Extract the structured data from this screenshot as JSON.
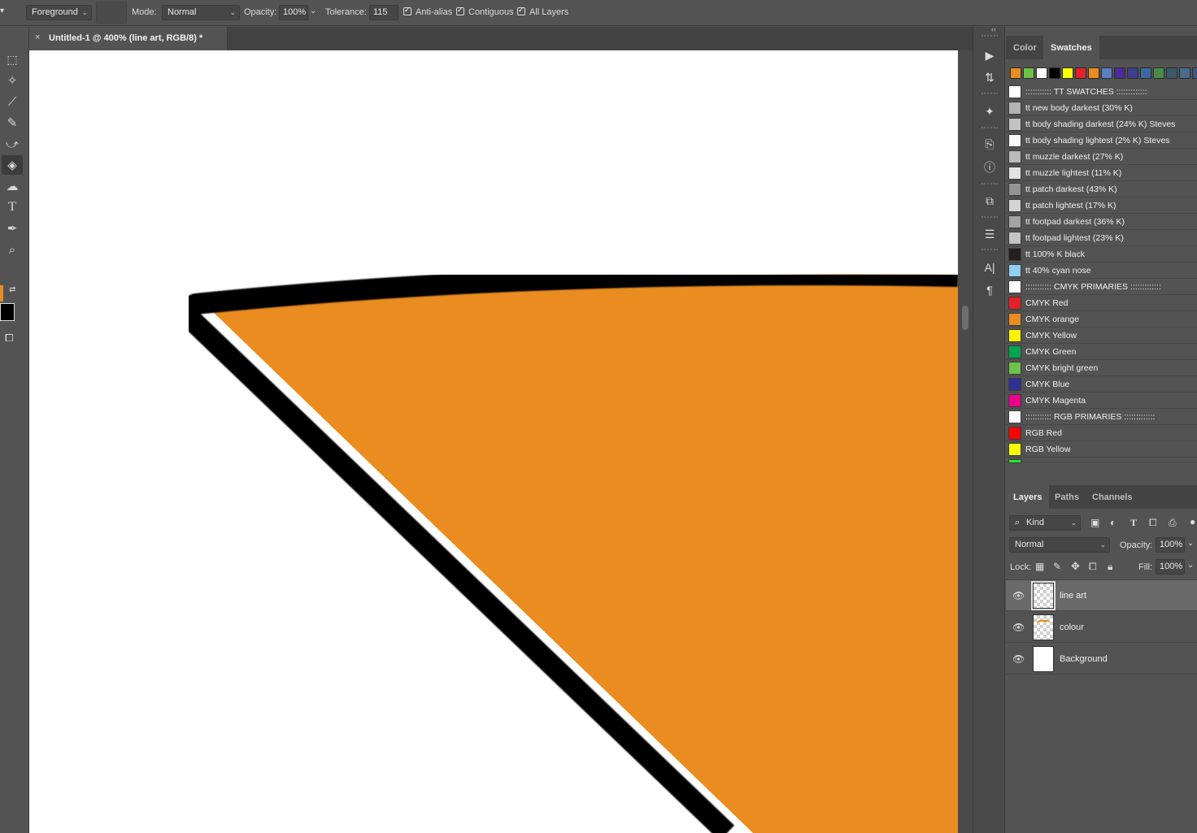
{
  "options_bar": {
    "tool_icon": "paint-bucket-icon",
    "fill_source": "Foreground",
    "mode_label": "Mode:",
    "mode_value": "Normal",
    "opacity_label": "Opacity:",
    "opacity_value": "100%",
    "tolerance_label": "Tolerance:",
    "tolerance_value": "115",
    "anti_alias_label": "Anti-alias",
    "anti_alias_checked": true,
    "contiguous_label": "Contiguous",
    "contiguous_checked": true,
    "all_layers_label": "All Layers",
    "all_layers_checked": true
  },
  "document": {
    "tab_title": "Untitled-1 @ 400% (line art, RGB/8) *",
    "fill_color": "#ea8c1f",
    "line_color": "#000000"
  },
  "colors": {
    "foreground": "#ea8c1f",
    "background": "#000000"
  },
  "toolbar": {
    "tools": [
      {
        "name": "marquee-tool",
        "glyph": "⬚"
      },
      {
        "name": "magic-wand-tool",
        "glyph": "✧"
      },
      {
        "name": "eyedropper-tool",
        "glyph": "⟋"
      },
      {
        "name": "brush-tool",
        "glyph": "✎"
      },
      {
        "name": "history-brush-tool",
        "glyph": "⤻"
      },
      {
        "name": "paint-bucket-tool",
        "glyph": "◈"
      },
      {
        "name": "smudge-tool",
        "glyph": "☁"
      },
      {
        "name": "type-tool",
        "glyph": "T"
      },
      {
        "name": "pen-tool",
        "glyph": "✒"
      },
      {
        "name": "zoom-tool",
        "glyph": "⌕"
      }
    ]
  },
  "right_icons": [
    {
      "name": "play-icon",
      "glyph": "▶"
    },
    {
      "name": "history-icon",
      "glyph": "⇅"
    },
    {
      "name": "brushes-icon",
      "glyph": "✦"
    },
    {
      "name": "clone-source-icon",
      "glyph": "⎘"
    },
    {
      "name": "info-icon",
      "glyph": "ⓘ"
    },
    {
      "name": "transform-icon",
      "glyph": "⧉"
    },
    {
      "name": "adjustments-icon",
      "glyph": "☰"
    },
    {
      "name": "character-icon",
      "glyph": "A|"
    },
    {
      "name": "paragraph-icon",
      "glyph": "¶"
    }
  ],
  "swatches_panel": {
    "tabs": [
      "Color",
      "Swatches"
    ],
    "active_tab": "Swatches",
    "recent_colors": [
      "#ea8c1f",
      "#6cc24a",
      "#ffffff",
      "#000000",
      "#ffff00",
      "#e4202a",
      "#ea8c1f",
      "#5b7fbf",
      "#4a2c9a",
      "#3f3f90",
      "#3c6aa0",
      "#4c8a4c",
      "#3a5a6a",
      "#496a8a",
      "#3d5a80"
    ],
    "items": [
      {
        "label": "::::::::::: TT SWATCHES :::::::::::::",
        "color": "#ffffff"
      },
      {
        "label": "tt new body darkest (30% K)",
        "color": "#b3b3b3"
      },
      {
        "label": "tt body shading darkest (24% K) Steves",
        "color": "#c2c2c2"
      },
      {
        "label": "tt body shading lightest (2% K) Steves",
        "color": "#f9f9f9"
      },
      {
        "label": "tt muzzle darkest (27% K)",
        "color": "#bababa"
      },
      {
        "label": "tt muzzle lightest (11% K)",
        "color": "#e3e3e3"
      },
      {
        "label": "tt patch darkest (43% K)",
        "color": "#939393"
      },
      {
        "label": "tt patch lightest (17% K)",
        "color": "#d4d4d4"
      },
      {
        "label": "tt footpad darkest (36% K)",
        "color": "#a3a3a3"
      },
      {
        "label": "tt footpad lightest (23% K)",
        "color": "#c4c4c4"
      },
      {
        "label": "tt 100% K black",
        "color": "#231f20"
      },
      {
        "label": "tt 40% cyan nose",
        "color": "#8fd0f3"
      },
      {
        "label": "::::::::::: CMYK PRIMARIES :::::::::::::",
        "color": "#ffffff"
      },
      {
        "label": "CMYK Red",
        "color": "#e4202a"
      },
      {
        "label": "CMYK orange",
        "color": "#ea8c1f"
      },
      {
        "label": "CMYK Yellow",
        "color": "#fff200"
      },
      {
        "label": "CMYK Green",
        "color": "#00a651"
      },
      {
        "label": "CMYK bright green",
        "color": "#6cc24a"
      },
      {
        "label": "CMYK Blue",
        "color": "#2e3192"
      },
      {
        "label": "CMYK Magenta",
        "color": "#ec008c"
      },
      {
        "label": "::::::::::: RGB PRIMARIES :::::::::::::",
        "color": "#ffffff"
      },
      {
        "label": "RGB Red",
        "color": "#ff0000"
      },
      {
        "label": "RGB Yellow",
        "color": "#ffff00"
      }
    ]
  },
  "layers_panel": {
    "tabs": [
      "Layers",
      "Paths",
      "Channels"
    ],
    "active_tab": "Layers",
    "filter_label": "Kind",
    "blend_mode": "Normal",
    "opacity_label": "Opacity:",
    "opacity_value": "100%",
    "lock_label": "Lock:",
    "fill_label": "Fill:",
    "fill_value": "100%",
    "layers": [
      {
        "name": "line art",
        "selected": true,
        "visible": true,
        "thumb": "transparent"
      },
      {
        "name": "colour",
        "selected": false,
        "visible": true,
        "thumb": "colour"
      },
      {
        "name": "Background",
        "selected": false,
        "visible": true,
        "thumb": "white"
      }
    ]
  }
}
